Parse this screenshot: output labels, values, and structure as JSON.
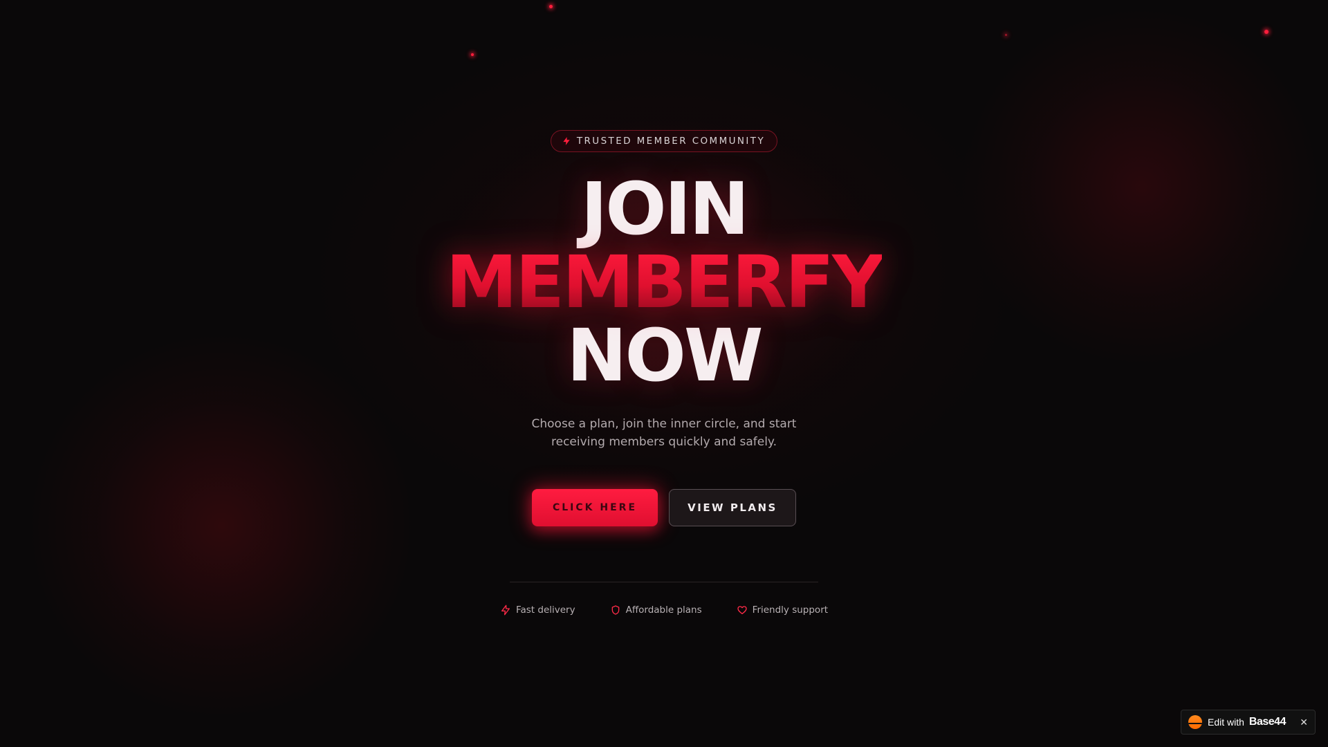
{
  "badge": {
    "icon": "bolt-icon",
    "label": "TRUSTED MEMBER COMMUNITY"
  },
  "headline": {
    "line1": "JOIN",
    "line2": "MEMBERFY",
    "line3": "NOW"
  },
  "subtitle": "Choose a plan, join the inner circle, and start receiving members quickly and safely.",
  "cta": {
    "primary_label": "CLICK HERE",
    "secondary_label": "VIEW PLANS"
  },
  "features": [
    {
      "icon": "bolt-icon",
      "label": "Fast delivery"
    },
    {
      "icon": "shield-icon",
      "label": "Affordable plans"
    },
    {
      "icon": "heart-icon",
      "label": "Friendly support"
    }
  ],
  "edit_widget": {
    "text": "Edit with",
    "brand": "Base44",
    "close": "✕"
  },
  "colors": {
    "accent": "#e8102f",
    "background": "#0a0809",
    "text": "#f6eef0"
  }
}
